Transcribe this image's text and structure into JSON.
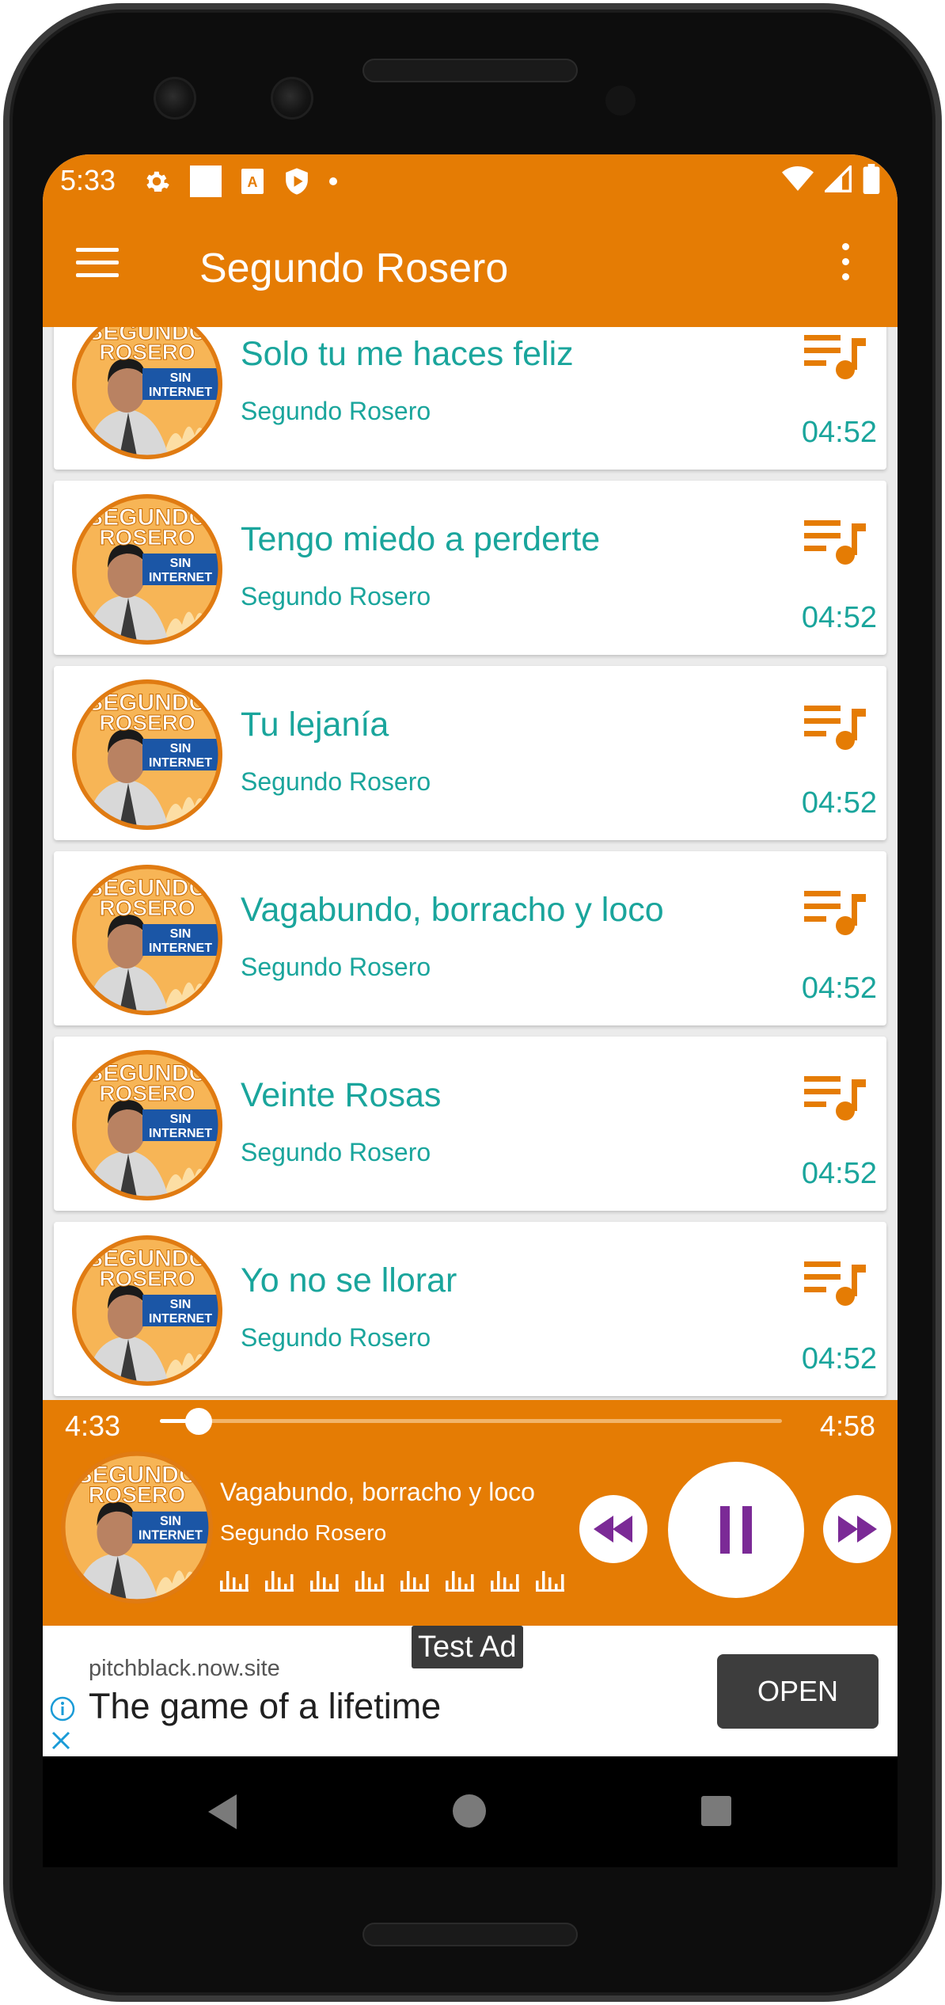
{
  "status_bar": {
    "time": "5:33",
    "left_icons": [
      "settings-icon",
      "square-icon",
      "text-a-icon",
      "shield-play-icon",
      "dot-icon"
    ],
    "right_icons": [
      "wifi-icon",
      "cell-signal-icon",
      "battery-icon"
    ]
  },
  "app_bar": {
    "title": "Segundo Rosero"
  },
  "songs": [
    {
      "title": "Solo tu me haces feliz",
      "artist": "Segundo Rosero",
      "duration": "04:52"
    },
    {
      "title": "Tengo miedo a perderte",
      "artist": "Segundo Rosero",
      "duration": "04:52"
    },
    {
      "title": "Tu lejanía",
      "artist": "Segundo Rosero",
      "duration": "04:52"
    },
    {
      "title": "Vagabundo, borracho y loco",
      "artist": "Segundo Rosero",
      "duration": "04:52"
    },
    {
      "title": "Veinte Rosas",
      "artist": "Segundo Rosero",
      "duration": "04:52"
    },
    {
      "title": "Yo no se llorar",
      "artist": "Segundo Rosero",
      "duration": "04:52"
    }
  ],
  "album_art": {
    "line1": "SEGUNDO",
    "line2": "ROSERO",
    "badge1": "SIN",
    "badge2": "INTERNET"
  },
  "player": {
    "current_time": "4:33",
    "total_time": "4:58",
    "progress": 0.062,
    "title": "Vagabundo, borracho y loco",
    "artist": "Segundo Rosero",
    "state": "playing"
  },
  "ad": {
    "badge": "Test Ad",
    "domain": "pitchblack.now.site",
    "headline": "The game of a lifetime",
    "cta": "OPEN"
  },
  "colors": {
    "primary": "#e57c04",
    "accent_text": "#1aa59c",
    "player_icon": "#7b2a96"
  }
}
